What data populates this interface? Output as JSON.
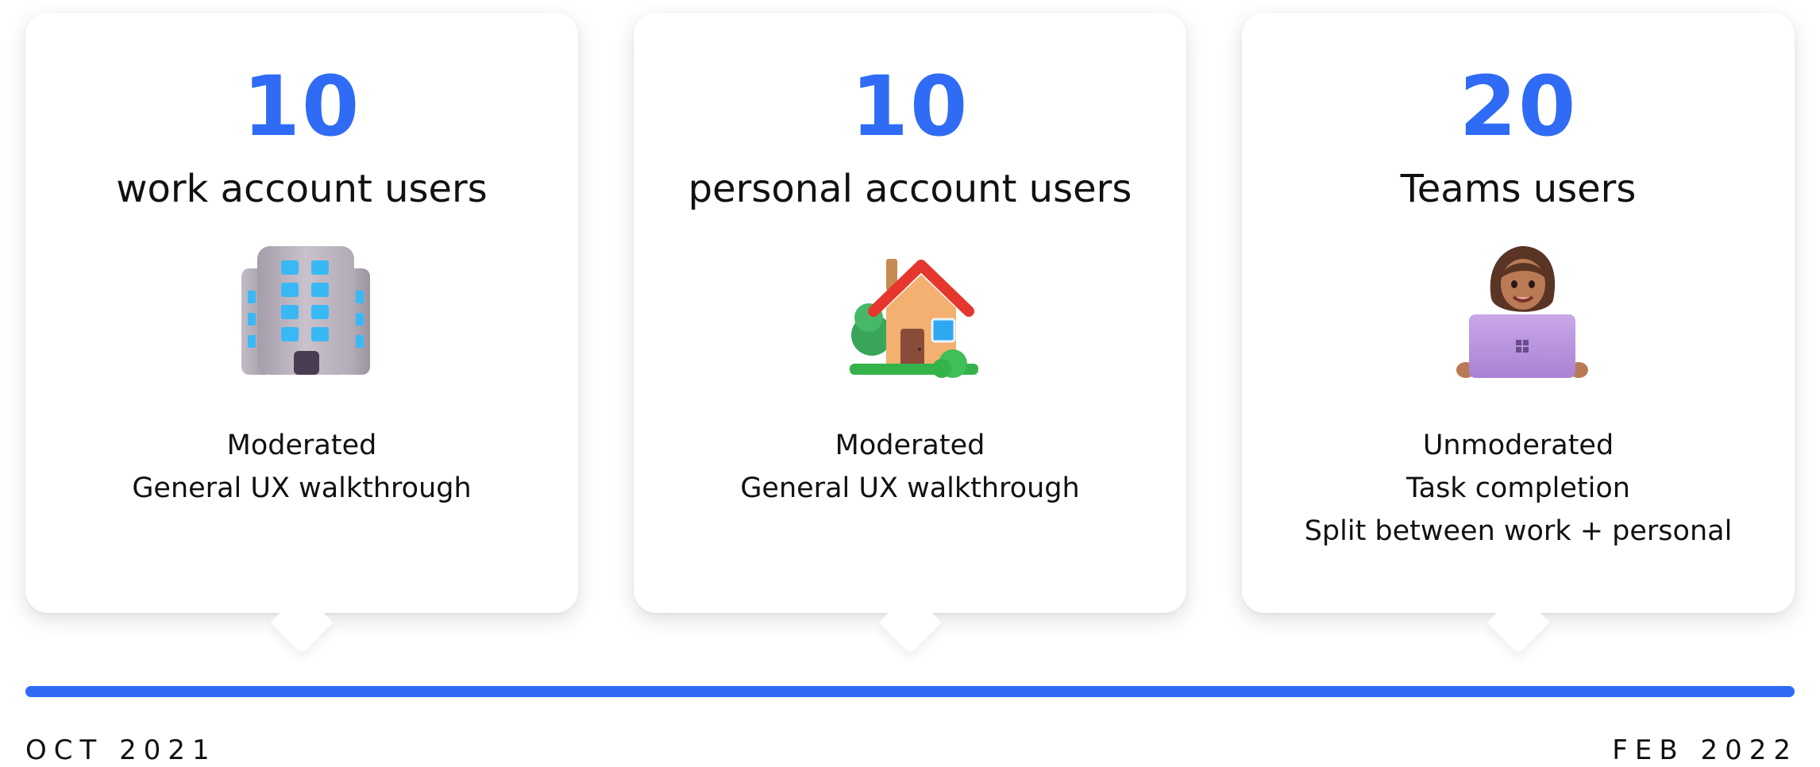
{
  "cards": [
    {
      "count": "10",
      "label": "work account users",
      "icon": "office-building-icon",
      "lines": [
        "Moderated",
        "General UX walkthrough"
      ]
    },
    {
      "count": "10",
      "label": "personal account users",
      "icon": "house-with-garden-icon",
      "lines": [
        "Moderated",
        "General UX walkthrough"
      ]
    },
    {
      "count": "20",
      "label": "Teams users",
      "icon": "woman-with-laptop-icon",
      "lines": [
        "Unmoderated",
        "Task completion",
        "Split between work + personal"
      ]
    }
  ],
  "timeline": {
    "start_label": "OCT 2021",
    "end_label": "FEB 2022",
    "color": "#2f6bf5"
  },
  "colors": {
    "accent": "#2f6bf5",
    "text": "#111111",
    "card": "#ffffff"
  }
}
